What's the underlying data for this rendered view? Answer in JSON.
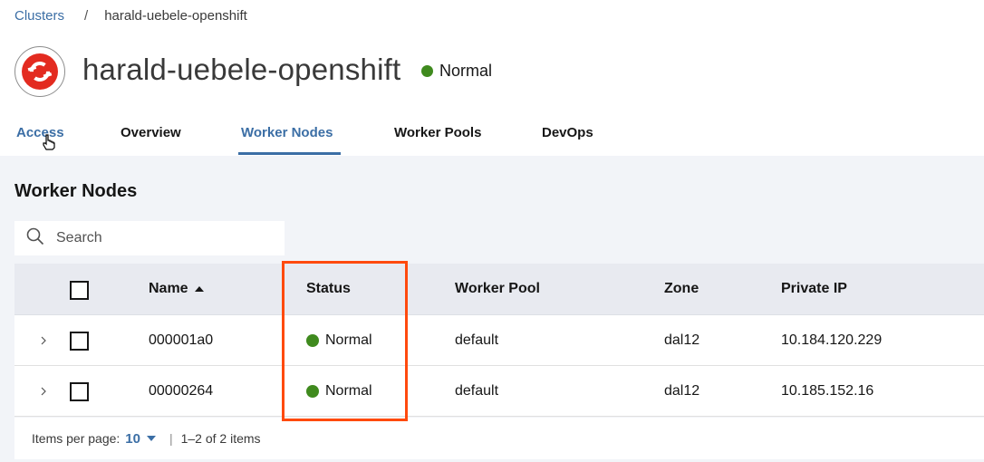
{
  "breadcrumb": {
    "root": "Clusters",
    "separator": "/",
    "current": "harald-uebele-openshift"
  },
  "header": {
    "title": "harald-uebele-openshift",
    "status": "Normal"
  },
  "tabs": [
    {
      "label": "Access"
    },
    {
      "label": "Overview"
    },
    {
      "label": "Worker Nodes"
    },
    {
      "label": "Worker Pools"
    },
    {
      "label": "DevOps"
    }
  ],
  "section": {
    "title": "Worker Nodes"
  },
  "search": {
    "placeholder": "Search"
  },
  "table": {
    "columns": {
      "name": "Name",
      "status": "Status",
      "pool": "Worker Pool",
      "zone": "Zone",
      "ip": "Private IP"
    },
    "rows": [
      {
        "name": "000001a0",
        "status": "Normal",
        "pool": "default",
        "zone": "dal12",
        "ip": "10.184.120.229"
      },
      {
        "name": "00000264",
        "status": "Normal",
        "pool": "default",
        "zone": "dal12",
        "ip": "10.185.152.16"
      }
    ]
  },
  "pagination": {
    "items_per_page_label": "Items per page:",
    "items_per_page": "10",
    "range": "1–2 of 2 items"
  },
  "colors": {
    "accent": "#3b6ea5",
    "status_normal": "#3f8a1e",
    "highlight": "#ff4a0e",
    "logo": "#e32b20"
  }
}
